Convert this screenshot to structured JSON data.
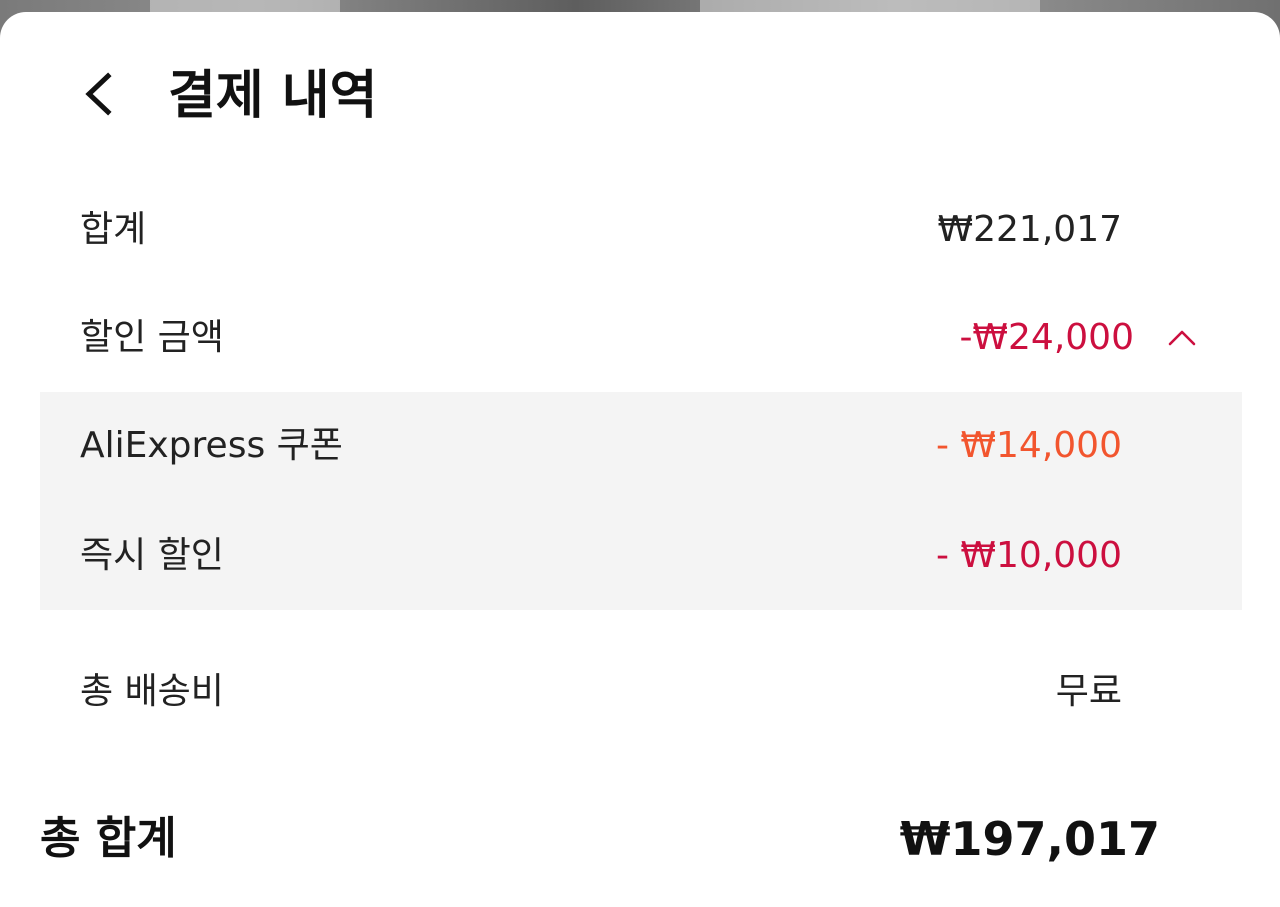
{
  "colors": {
    "discount_total": "#cc0f3f",
    "coupon": "#f2552e",
    "instant_discount": "#cc0f3f",
    "text": "#222222"
  },
  "header": {
    "back_icon": "chevron-left-icon",
    "title": "결제 내역"
  },
  "summary": {
    "subtotal": {
      "label": "합계",
      "value": "₩221,017"
    },
    "discount": {
      "label": "할인 금액",
      "value": "-₩24,000",
      "toggle_icon": "chevron-up-icon",
      "expanded": true
    },
    "discount_items": [
      {
        "label": "AliExpress 쿠폰",
        "value": "- ₩14,000"
      },
      {
        "label": "즉시 할인",
        "value": "- ₩10,000"
      }
    ],
    "shipping": {
      "label": "총 배송비",
      "value": "무료"
    },
    "total": {
      "label": "총 합계",
      "value": "₩197,017"
    }
  }
}
